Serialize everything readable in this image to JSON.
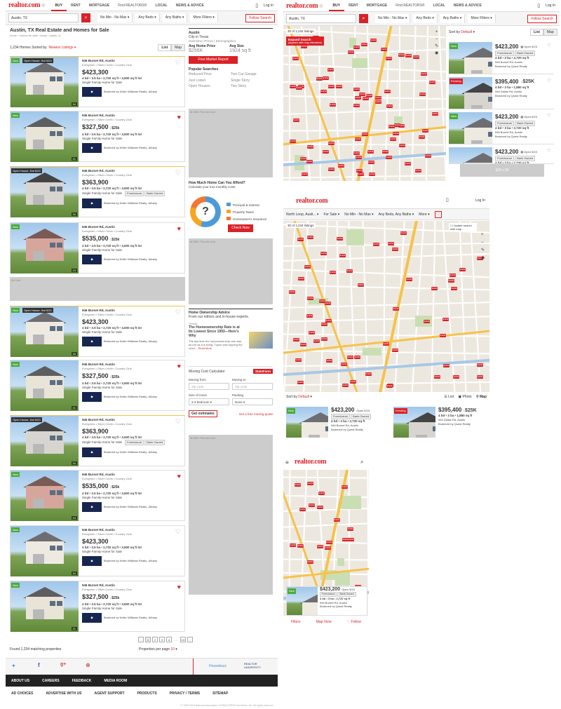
{
  "brand": {
    "logo": "realtor.com",
    "accent": "#d92228"
  },
  "nav": {
    "items": [
      "BUY",
      "RENT",
      "MORTGAGE",
      "Find REALTORS®",
      "LOCAL",
      "NEWS & ADVICE"
    ],
    "login": "Log In"
  },
  "search": {
    "location": "Austin, TX",
    "price": "No Min - No Max",
    "beds": "Any Beds",
    "baths": "Any Baths",
    "more": "More Filters",
    "follow": "Follow Search"
  },
  "page": {
    "title": "Austin, TX Real Estate and Homes for Sale",
    "breadcrumb": "home › homes for sale › texas › austin, tx",
    "count": "1,234 Homes Sorted by",
    "sort": "Newest Listings",
    "list": "List",
    "map": "Map"
  },
  "listings": [
    {
      "badge_new": "New",
      "badge_oh": "Open House, Sat 5/23",
      "addr": "946 Burnet Rd, Austin",
      "area": "Evergreen • Silver Creek • Country Club",
      "price": "$423,300",
      "change": "",
      "specs": "4 bd • 3.5 ba • 2,720 sq ft • 3,600 sq ft lot",
      "type": "Single Family Home for Sale",
      "broker": "Brokered by Keller Williams Realty -Albany",
      "photos": "34",
      "fav": false
    },
    {
      "badge_new": "New",
      "badge_oh": "",
      "addr": "946 Burnet Rd, Austin",
      "area": "Evergreen • Silver Creek • Country Club",
      "price": "$327,500",
      "change": "$25k",
      "specs": "4 bd • 3.5 ba • 2,720 sq ft • 3,600 sq ft lot",
      "type": "Single Family Home for Sale",
      "broker": "Brokered by Keller Williams Realty -Albany",
      "photos": "21",
      "fav": true
    },
    {
      "badge_new": "",
      "badge_oh": "Open House, Sat 5/23",
      "addr": "946 Burnet Rd, Austin",
      "area": "Evergreen • Silver Creek • Country Club",
      "price": "$363,900",
      "change": "",
      "specs": "4 bd • 3.5 ba • 2,720 sq ft • 3,600 sq ft lot",
      "type": "Single Family Home for Sale",
      "broker": "Brokered by Keller Williams Realty -Albany",
      "photos": "34",
      "fav": false
    },
    {
      "badge_new": "New",
      "badge_oh": "",
      "addr": "946 Burnet Rd, Austin",
      "area": "Evergreen • Silver Creek • Country Club",
      "price": "$535,000",
      "change": "$25k",
      "specs": "4 bd • 3.5 ba • 2,720 sq ft • 3,600 sq ft lot",
      "type": "Single Family Home for Sale",
      "broker": "Brokered by Keller Williams Realty -Albany",
      "photos": "19",
      "fav": true
    },
    {
      "badge_new": "New",
      "badge_oh": "Open House, Sat 5/23",
      "addr": "946 Burnet Rd, Austin",
      "area": "Evergreen • Silver Creek • Country Club",
      "price": "$423,300",
      "change": "",
      "specs": "4 bd • 3.5 ba • 2,720 sq ft • 3,600 sq ft lot",
      "type": "Single Family Home for Sale",
      "broker": "Brokered by Keller Williams Realty -Albany",
      "photos": "34",
      "fav": false
    },
    {
      "badge_new": "New",
      "badge_oh": "",
      "addr": "946 Burnet Rd, Austin",
      "area": "Evergreen • Silver Creek • Country Club",
      "price": "$327,500",
      "change": "$25k",
      "specs": "4 bd • 3.5 ba • 2,720 sq ft • 3,600 sq ft lot",
      "type": "Single Family Home for Sale",
      "broker": "Brokered by Keller Williams Realty -Albany",
      "photos": "21",
      "fav": true
    },
    {
      "badge_new": "",
      "badge_oh": "Open House, Sat 5/23",
      "addr": "946 Burnet Rd, Austin",
      "area": "Evergreen • Silver Creek • Country Club",
      "price": "$363,900",
      "change": "",
      "specs": "4 bd • 3.5 ba • 2,720 sq ft • 3,600 sq ft lot",
      "type": "Single Family Home for Sale",
      "broker": "Brokered by Keller Williams Realty -Albany",
      "photos": "34",
      "fav": false
    },
    {
      "badge_new": "New",
      "badge_oh": "",
      "addr": "946 Burnet Rd, Austin",
      "area": "Evergreen • Silver Creek • Country Club",
      "price": "$535,000",
      "change": "$25k",
      "specs": "4 bd • 3.5 ba • 2,720 sq ft • 3,600 sq ft lot",
      "type": "Single Family Home for Sale",
      "broker": "Brokered by Keller Williams Realty -Albany",
      "photos": "19",
      "fav": true
    },
    {
      "badge_new": "New",
      "badge_oh": "",
      "addr": "946 Burnet Rd, Austin",
      "area": "Evergreen • Silver Creek • Country Club",
      "price": "$423,300",
      "change": "",
      "specs": "4 bd • 3.5 ba • 2,720 sq ft • 3,600 sq ft lot",
      "type": "Single Family Home for Sale",
      "broker": "Brokered by Keller Williams Realty -Albany",
      "photos": "34",
      "fav": false
    },
    {
      "badge_new": "New",
      "badge_oh": "",
      "addr": "946 Burnet Rd, Austin",
      "area": "Evergreen • Silver Creek • Country Club",
      "price": "$327,500",
      "change": "$25k",
      "specs": "4 bd • 3.5 ba • 2,720 sq ft • 3,600 sq ft lot",
      "type": "Single Family Home for Sale",
      "broker": "Brokered by Keller Williams Realty -Albany",
      "photos": "21",
      "fav": true
    }
  ],
  "sidebar": {
    "city": "Austin",
    "city_sub": "City in Texas",
    "links": "Overview | Prices | Demographics",
    "avg_price_label": "Avg Home Price",
    "avg_price": "$256K",
    "avg_size_label": "Avg Size",
    "avg_size": "1924 sq ft",
    "report_btn": "Free Market Report",
    "popular": "Popular Searches",
    "searches": [
      "Reduced Price",
      "Two Car Garage",
      "Just Listed",
      "Single Story",
      "Open Houses",
      "Two Story"
    ],
    "ad1": "M-RBC Flex Ad Unit",
    "afford_title": "How Much Home Can You Afford?",
    "afford_sub": "Calculate your true monthly costs",
    "afford_items": [
      "Principal & Interest",
      "Property Taxes",
      "Homeowner's Insurance"
    ],
    "check_btn": "Check Now",
    "ad2": "M-RBC Flex Ad Unit",
    "advice_title": "Home Ownership Advice",
    "advice_sub": "From our editors and in-house experts.",
    "trend": "Trends",
    "article": "The Homeownership Rate is at Its Lowest Since 1993—Here's Why",
    "article_body": "The last time the homeownership rate was as low as it is today, Tupac was topping the chart...",
    "read_more": "Read More",
    "moving_title": "Moving Cost Calculator",
    "sponsor": "StateFarm",
    "moving_from": "Moving from",
    "moving_to": "Moving to",
    "zip": "Zip code",
    "size_label": "Size of move",
    "size_val": "2-3 bedroom",
    "packing": "Packing",
    "packing_val": "None",
    "estimates_btn": "Get estimates",
    "quote_link": "Get a free moving quote",
    "ad3": "M-RBC Flex Ad Unit"
  },
  "results": {
    "found": "Found 1,234 matching properties",
    "per_page_label": "Properties per page",
    "per_page": "10",
    "pages": [
      "1",
      "2",
      "3",
      "4",
      "…",
      "13"
    ]
  },
  "ad_full": "Ad Unit",
  "footer": {
    "row1": [
      "ABOUT US",
      "CAREERS",
      "FEEDBACK",
      "MEDIA ROOM"
    ],
    "row2": [
      "AD CHOICES",
      "ADVERTISE WITH US",
      "AGENT SUPPORT",
      "PRODUCTS",
      "PRIVACY / TERMS",
      "SITEMAP"
    ],
    "copyright": "© 1995-2015 National Association of REALTORS® and Move, Inc. All rights reserved.",
    "partner1": "Housebuzz",
    "partner2": "REALTOR UNIVERSITY"
  },
  "mapview": {
    "count": "30 of 1,234 listings",
    "expand": "Expand Search",
    "expand_note": "(Appears after map interaction)",
    "sort": "Sort by",
    "sort_val": "Default",
    "cards": [
      {
        "price": "$423,200",
        "open": "Open 5/23",
        "tags": [
          "Foreclosure",
          "Bank Owned"
        ],
        "specs": "4 bd • 3 ba • 2,720 sq ft",
        "addr": "946 Burnet Rd, Austin",
        "broker": "Brokered by Quest Realty",
        "badge": "New"
      },
      {
        "price": "$395,400",
        "change": "$25K",
        "specs": "4 bd • 3 ba • 1,880 sq ft",
        "addr": "946 Dallas Rd, Austin",
        "broker": "Brokered by Quest Realty",
        "badge": "Pending"
      },
      {
        "price": "$423,200",
        "open": "Open 5/23",
        "tags": [
          "Foreclosure",
          "Bank Owned"
        ],
        "specs": "4 bd • 3 ba • 2,720 sq ft",
        "addr": "946 Burnet Rd, Austin",
        "broker": "Brokered by Quest Realty",
        "badge": "New"
      },
      {
        "price": "$423,200",
        "open": "Open 5/23",
        "tags": [
          "Foreclosure",
          "Bank Owned"
        ],
        "specs": "4 bd • 3 ba • 2,720 sq ft",
        "addr": "946 Burnet Rd, Austin",
        "broker": "",
        "badge": ""
      }
    ],
    "ad": "320 x 50"
  },
  "tablet": {
    "location": "North Loop, Austi...",
    "forsale": "For Sale",
    "price": "No Min - No Max",
    "beds": "Any Beds, Any Baths",
    "more": "More",
    "count": "30 of 1,234 listings",
    "update": "Update search with map",
    "sort": "Sort by",
    "sort_val": "Default",
    "list": "List",
    "photo": "Photo",
    "map": "Map"
  },
  "mobile": {
    "filters": "Filters",
    "mapview": "Map View",
    "follow": "Follow",
    "pins": "$423k"
  }
}
